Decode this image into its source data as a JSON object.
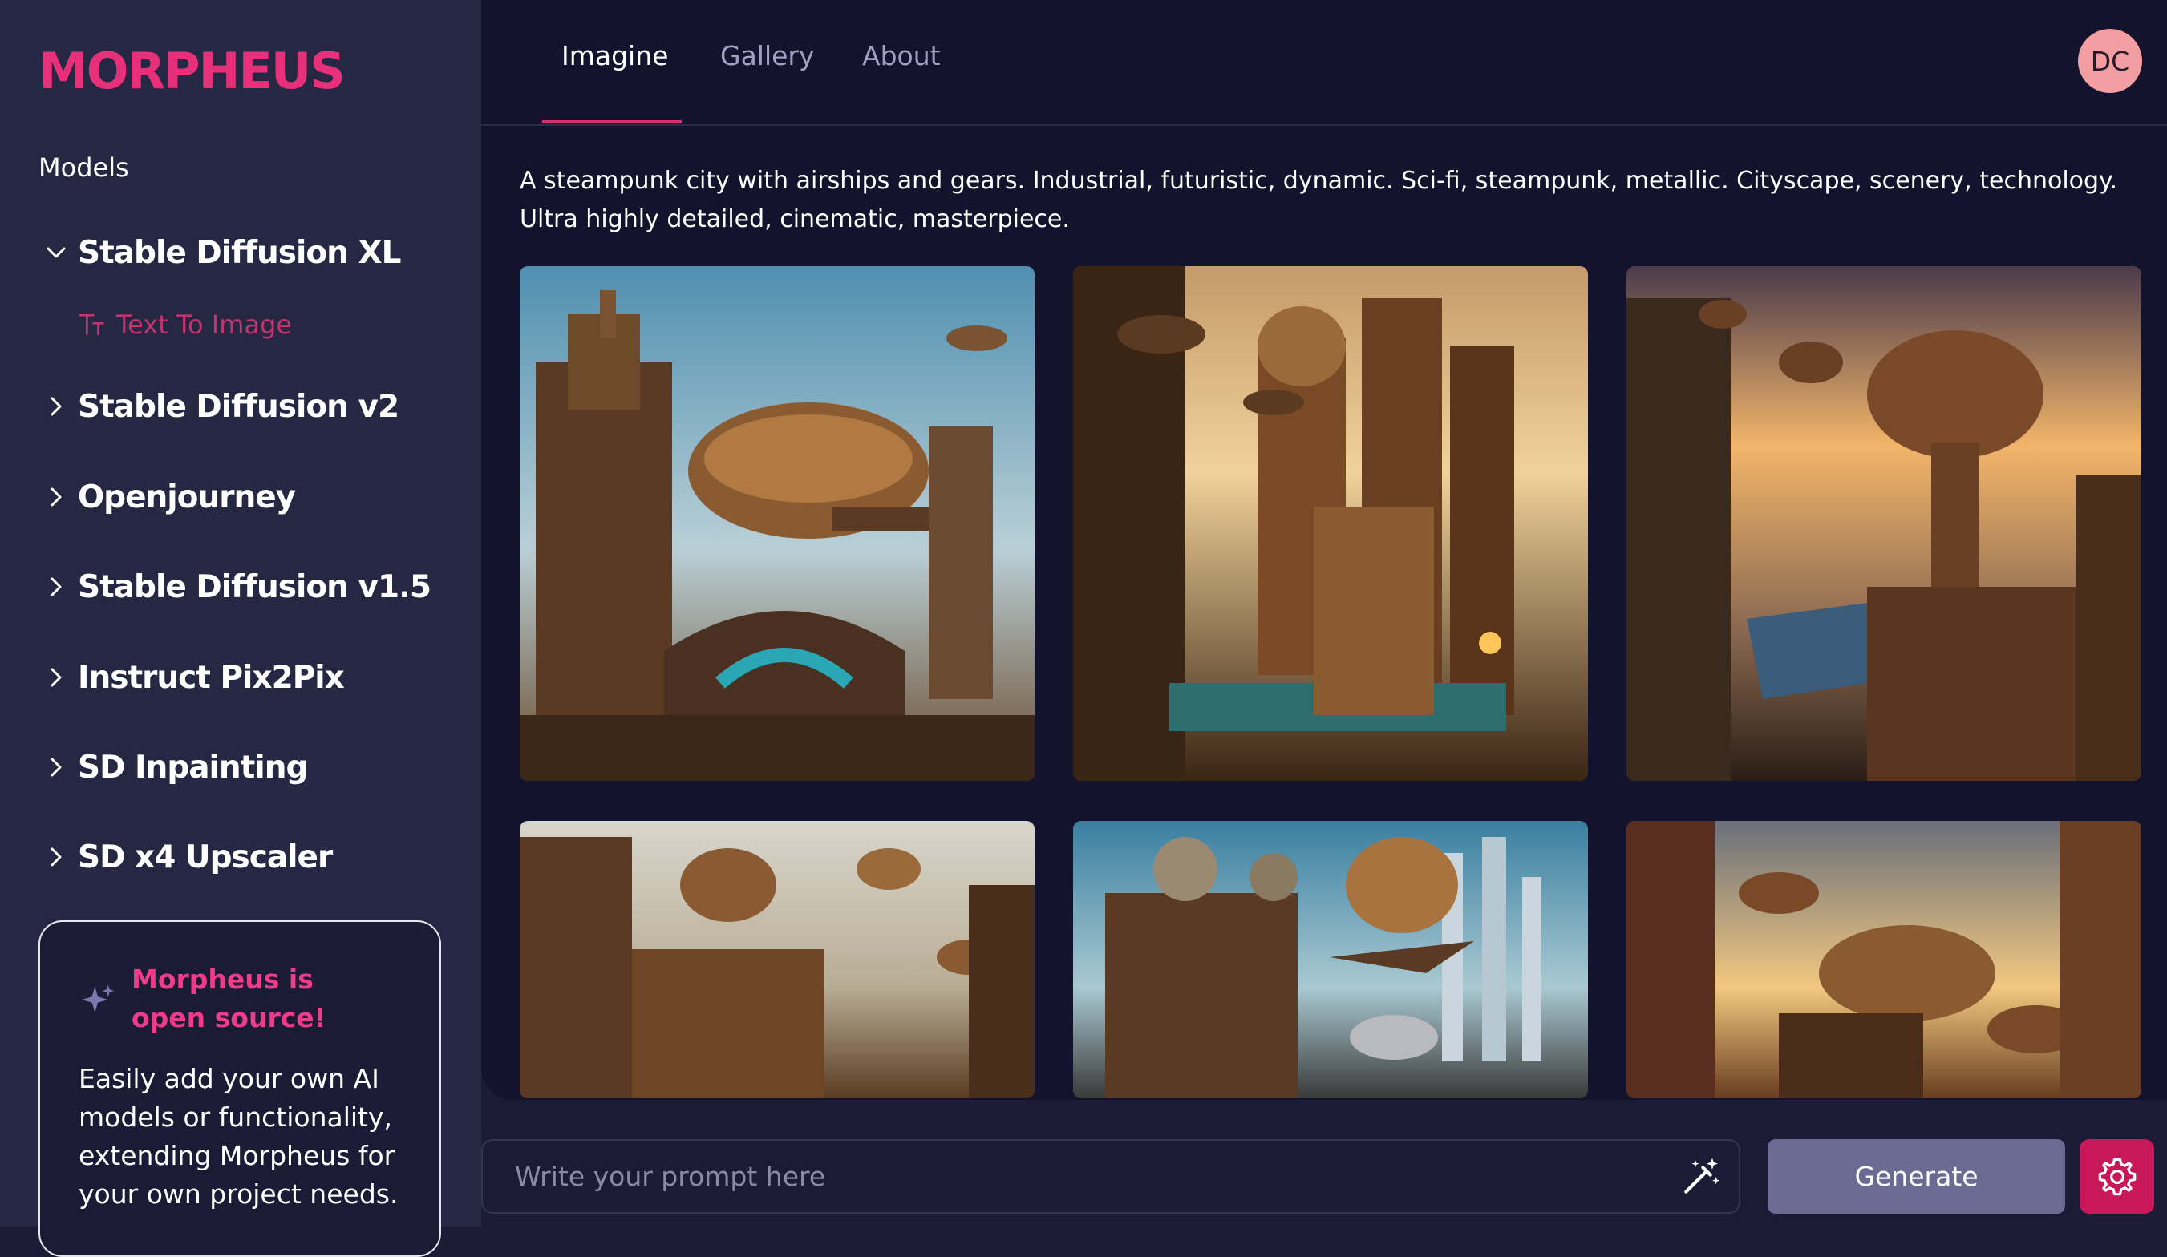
{
  "brand": {
    "name": "MORPHEUS",
    "color": "#e8307a"
  },
  "sidebar": {
    "heading": "Models",
    "models": [
      {
        "label": "Stable Diffusion XL",
        "expanded": true,
        "sub_items": [
          {
            "label": "Text To Image",
            "icon": "text-to-image-icon"
          }
        ]
      },
      {
        "label": "Stable Diffusion v2",
        "expanded": false
      },
      {
        "label": "Openjourney",
        "expanded": false
      },
      {
        "label": "Stable Diffusion v1.5",
        "expanded": false
      },
      {
        "label": "Instruct Pix2Pix",
        "expanded": false
      },
      {
        "label": "SD Inpainting",
        "expanded": false
      },
      {
        "label": "SD x4 Upscaler",
        "expanded": false
      }
    ],
    "promo": {
      "title": "Morpheus is open source!",
      "body": "Easily add your own AI models or functionality, extending Morpheus for your own project needs."
    }
  },
  "nav": {
    "tabs": [
      {
        "label": "Imagine",
        "active": true
      },
      {
        "label": "Gallery",
        "active": false
      },
      {
        "label": "About",
        "active": false
      }
    ],
    "avatar_initials": "DC"
  },
  "main": {
    "prompt_text": "A steampunk city with airships and gears. Industrial, futuristic, dynamic. Sci-fi, steampunk, metallic. Cityscape, scenery, technology. Ultra highly detailed, cinematic, masterpiece.",
    "images": [
      {
        "name": "generated-image-1",
        "sky": "#8fb4c8"
      },
      {
        "name": "generated-image-2",
        "sky": "#d8a66a"
      },
      {
        "name": "generated-image-3",
        "sky": "#e0a060"
      },
      {
        "name": "generated-image-4",
        "sky": "#c9c3b0"
      },
      {
        "name": "generated-image-5",
        "sky": "#7fb0c4"
      },
      {
        "name": "generated-image-6",
        "sky": "#d99a5a"
      }
    ]
  },
  "prompt_bar": {
    "placeholder": "Write your prompt here",
    "generate_label": "Generate"
  },
  "colors": {
    "accent": "#e8307a",
    "sidebar_bg": "#262742",
    "main_bg": "#13132e",
    "generate_bg": "#6b6a92",
    "settings_bg": "#c8185a"
  }
}
